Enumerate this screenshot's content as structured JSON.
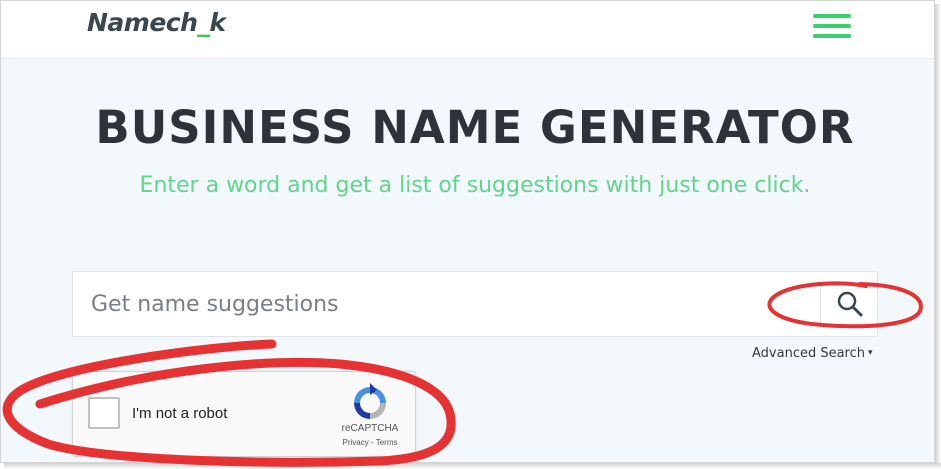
{
  "header": {
    "logo_main": "Namech",
    "logo_accent": "_",
    "logo_tail": "k",
    "menu_icon": "hamburger-menu-icon",
    "accent_color": "#3ccf6e"
  },
  "hero": {
    "title": "BUSINESS NAME GENERATOR",
    "subtitle": "Enter a word and get a list of suggestions with just one click."
  },
  "search": {
    "placeholder": "Get name suggestions",
    "value": "",
    "button_icon": "search-icon"
  },
  "advanced_search": {
    "label": "Advanced Search",
    "caret": "▾"
  },
  "captcha": {
    "label": "I'm not a robot",
    "brand": "reCAPTCHA",
    "privacy": "Privacy",
    "separator": " - ",
    "terms": "Terms"
  },
  "annotation_color": "#e63232"
}
